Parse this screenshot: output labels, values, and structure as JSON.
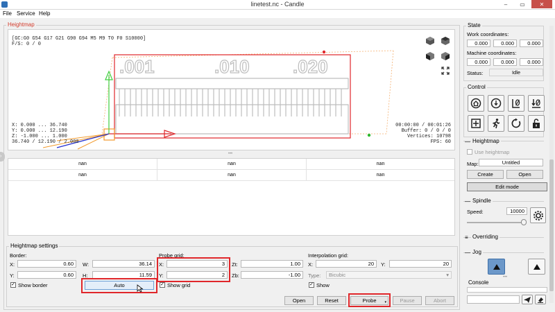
{
  "window": {
    "title": "linetest.nc - Candle",
    "min": "–",
    "max": "▭",
    "close": "✕"
  },
  "menu": [
    "File",
    "Service",
    "Help"
  ],
  "heightmap_panel": {
    "title": "Heightmap"
  },
  "viewport": {
    "status_line1": "[GC:G0 G54 G17 G21 G90 G94 M5 M9 T0 F0 S10000]",
    "status_line2": "F/S: 0 / 0",
    "bounds": [
      "X: 0.000 ... 36.740",
      "Y: 0.000 ... 12.190",
      "Z: -1.000 ... 1.000",
      "36.740 / 12.190 / 2.000"
    ],
    "stats": [
      "00:00:00 / 00:01:26",
      "Buffer: 0 / 0 / 0",
      "Vertices: 10798",
      "FPS: 60"
    ],
    "labels": [
      ".001",
      ".010",
      ".020"
    ]
  },
  "table": {
    "rows": [
      [
        "nan",
        "nan",
        "nan"
      ],
      [
        "nan",
        "nan",
        "nan"
      ]
    ]
  },
  "heightmap_settings": {
    "title": "Heightmap settings",
    "border": {
      "title": "Border:",
      "x_label": "X:",
      "x": "0.60",
      "w_label": "W:",
      "w": "36.14",
      "y_label": "Y:",
      "y": "0.60",
      "h_label": "H:",
      "h": "11.59",
      "show_border": "Show border",
      "auto": "Auto"
    },
    "probe": {
      "title": "Probe grid:",
      "x_label": "X:",
      "x": "3",
      "y_label": "Y:",
      "y": "2",
      "zt_label": "Zt:",
      "zt": "1.00",
      "zb_label": "Zb:",
      "zb": "-1.00",
      "show_grid": "Show grid"
    },
    "interp": {
      "title": "Interpolation grid:",
      "x_label": "X:",
      "x": "20",
      "y_label": "Y:",
      "y": "20",
      "type_label": "Type:",
      "type": "Bicubic",
      "show": "Show"
    },
    "buttons": {
      "open": "Open",
      "reset": "Reset",
      "probe": "Probe",
      "pause": "Pause",
      "abort": "Abort"
    }
  },
  "state": {
    "title": "State",
    "work_label": "Work coordinates:",
    "work": [
      "0.000",
      "0.000",
      "0.000"
    ],
    "machine_label": "Machine coordinates:",
    "machine": [
      "0.000",
      "0.000",
      "0.000"
    ],
    "status_label": "Status:",
    "status": "Idle"
  },
  "control": {
    "title": "Control"
  },
  "heightmap_side": {
    "title": "Heightmap",
    "use": "Use heightmap",
    "map_label": "Map:",
    "map": "Untitled",
    "create": "Create",
    "open": "Open",
    "edit_mode": "Edit mode"
  },
  "spindle": {
    "title": "Spindle",
    "speed_label": "Speed:",
    "speed": "10000",
    "slider_pct": 95
  },
  "overriding": {
    "title": "Overriding"
  },
  "jog": {
    "title": "Jog"
  },
  "console": {
    "title": "Console"
  },
  "colors": {
    "accent_red": "#e0262a",
    "title_red": "#c7504a",
    "heightmap_title": "#d23a2a"
  }
}
